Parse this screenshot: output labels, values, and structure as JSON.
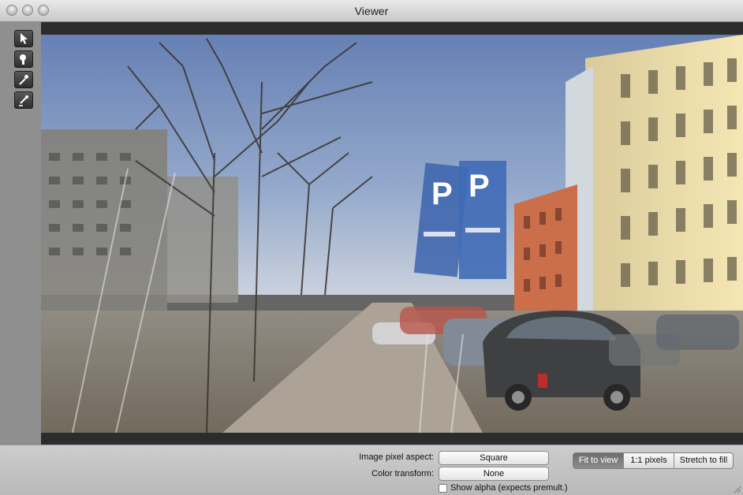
{
  "window": {
    "title": "Viewer"
  },
  "toolbar": {
    "tools": [
      {
        "name": "pointer-tool",
        "icon": "arrow-cursor-icon"
      },
      {
        "name": "magnifier-tool",
        "icon": "magnifier-icon"
      },
      {
        "name": "eyedropper-tool",
        "icon": "eyedropper-icon"
      },
      {
        "name": "eyedropper-alt-tool",
        "icon": "eyedropper-brush-icon"
      }
    ]
  },
  "viewer": {
    "image_subject": "street scene photo"
  },
  "controls": {
    "pixel_aspect_label": "Image pixel aspect:",
    "pixel_aspect_value": "Square",
    "color_transform_label": "Color transform:",
    "color_transform_value": "None",
    "show_alpha_label": "Show alpha (expects premult.)",
    "show_alpha_checked": false,
    "zoom_modes": [
      {
        "label": "Fit to view",
        "active": true
      },
      {
        "label": "1:1 pixels",
        "active": false
      },
      {
        "label": "Stretch to fill",
        "active": false
      }
    ]
  }
}
